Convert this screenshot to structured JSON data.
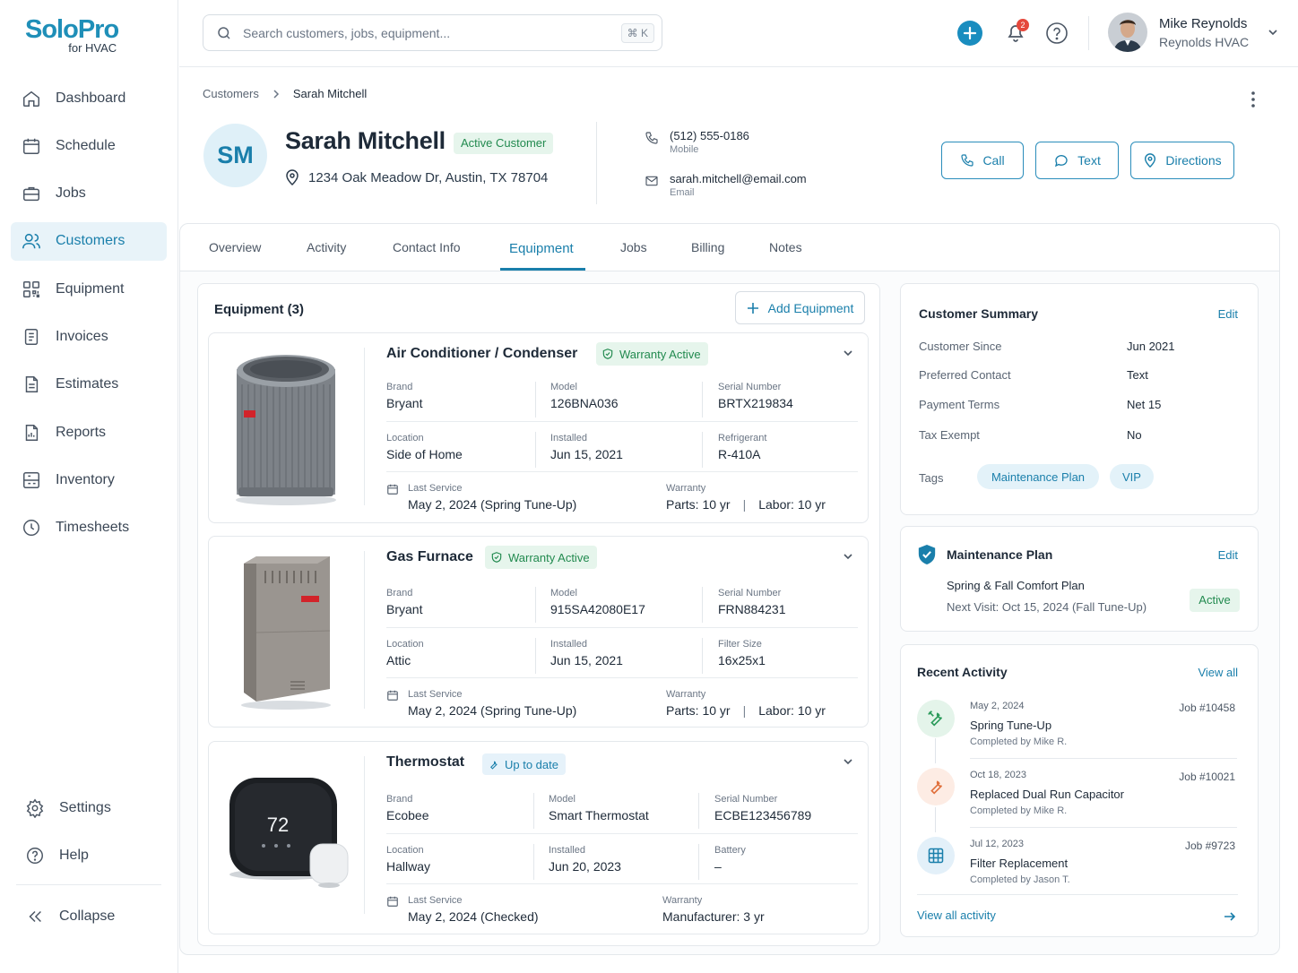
{
  "app": {
    "logo_main": "SoloPro",
    "logo_sub": "for HVAC"
  },
  "sidebar": {
    "items": [
      {
        "label": "Dashboard",
        "icon": "home-icon"
      },
      {
        "label": "Schedule",
        "icon": "calendar-icon"
      },
      {
        "label": "Jobs",
        "icon": "briefcase-icon"
      },
      {
        "label": "Customers",
        "icon": "users-icon",
        "active": true
      },
      {
        "label": "Equipment",
        "icon": "grid-icon"
      },
      {
        "label": "Invoices",
        "icon": "invoice-icon"
      },
      {
        "label": "Estimates",
        "icon": "estimate-icon"
      },
      {
        "label": "Reports",
        "icon": "report-icon"
      },
      {
        "label": "Inventory",
        "icon": "inventory-icon"
      },
      {
        "label": "Timesheets",
        "icon": "clock-icon"
      }
    ],
    "settings": "Settings",
    "help": "Help",
    "collapse": "Collapse"
  },
  "header": {
    "search_placeholder": "Search customers, jobs, equipment...",
    "shortcut": "⌘ K",
    "notification_count": "2",
    "user_name": "Mike Reynolds",
    "user_company": "Reynolds HVAC"
  },
  "breadcrumb": {
    "parent": "Customers",
    "current": "Sarah Mitchell"
  },
  "customer": {
    "initials": "SM",
    "name": "Sarah Mitchell",
    "status": "Active Customer",
    "address": "1234 Oak Meadow Dr, Austin, TX 78704",
    "phone": "(512) 555-0186",
    "phone_type": "Mobile",
    "email": "sarah.mitchell@email.com",
    "email_type": "Email"
  },
  "actions": {
    "call": "Call",
    "text": "Text",
    "directions": "Directions"
  },
  "tabs": [
    "Overview",
    "Activity",
    "Contact Info",
    "Equipment",
    "Jobs",
    "Billing",
    "Notes"
  ],
  "equipment": {
    "title": "Equipment (3)",
    "add_label": "Add Equipment",
    "items": [
      {
        "name": "Air Conditioner / Condenser",
        "badge": "Warranty Active",
        "f": [
          {
            "label": "Brand",
            "value": "Bryant"
          },
          {
            "label": "Model",
            "value": "126BNA036"
          },
          {
            "label": "Serial Number",
            "value": "BRTX219834"
          },
          {
            "label": "Location",
            "value": "Side of Home"
          },
          {
            "label": "Installed",
            "value": "Jun 15, 2021"
          },
          {
            "label": "Refrigerant",
            "value": "R-410A"
          }
        ],
        "last_service_label": "Last Service",
        "last_service": "May 2, 2024 (Spring Tune-Up)",
        "warranty_label": "Warranty",
        "warranty_parts": "Parts: 10 yr",
        "warranty_labor": "Labor: 10 yr"
      },
      {
        "name": "Gas Furnace",
        "badge": "Warranty Active",
        "f": [
          {
            "label": "Brand",
            "value": "Bryant"
          },
          {
            "label": "Model",
            "value": "915SA42080E17"
          },
          {
            "label": "Serial Number",
            "value": "FRN884231"
          },
          {
            "label": "Location",
            "value": "Attic"
          },
          {
            "label": "Installed",
            "value": "Jun 15, 2021"
          },
          {
            "label": "Filter Size",
            "value": "16x25x1"
          }
        ],
        "last_service_label": "Last Service",
        "last_service": "May 2, 2024 (Spring Tune-Up)",
        "warranty_label": "Warranty",
        "warranty_parts": "Parts: 10 yr",
        "warranty_labor": "Labor: 10 yr"
      },
      {
        "name": "Thermostat",
        "badge": "Up to date",
        "display_temp": "72",
        "f": [
          {
            "label": "Brand",
            "value": "Ecobee"
          },
          {
            "label": "Model",
            "value": "Smart Thermostat"
          },
          {
            "label": "Serial Number",
            "value": "ECBE123456789"
          },
          {
            "label": "Location",
            "value": "Hallway"
          },
          {
            "label": "Installed",
            "value": "Jun 20, 2023"
          },
          {
            "label": "Battery",
            "value": "–"
          }
        ],
        "last_service_label": "Last Service",
        "last_service": "May 2, 2024 (Checked)",
        "warranty_label": "Warranty",
        "warranty": "Manufacturer: 3 yr"
      }
    ]
  },
  "summary": {
    "title": "Customer Summary",
    "edit": "Edit",
    "rows": [
      {
        "label": "Customer Since",
        "value": "Jun 2021"
      },
      {
        "label": "Preferred Contact",
        "value": "Text"
      },
      {
        "label": "Payment Terms",
        "value": "Net 15"
      },
      {
        "label": "Tax Exempt",
        "value": "No"
      }
    ],
    "tags_label": "Tags",
    "tags": [
      "Maintenance Plan",
      "VIP"
    ]
  },
  "plan": {
    "title": "Maintenance Plan",
    "edit": "Edit",
    "name": "Spring & Fall Comfort Plan",
    "next_visit": "Next Visit: Oct 15, 2024 (Fall Tune-Up)",
    "status": "Active"
  },
  "activity": {
    "title": "Recent Activity",
    "view_all": "View all",
    "items": [
      {
        "date": "May 2, 2024",
        "name": "Spring Tune-Up",
        "by": "Completed by Mike R.",
        "job": "Job #10458"
      },
      {
        "date": "Oct 18, 2023",
        "name": "Replaced Dual Run Capacitor",
        "by": "Completed by Mike R.",
        "job": "Job #10021"
      },
      {
        "date": "Jul 12, 2023",
        "name": "Filter Replacement",
        "by": "Completed by Jason T.",
        "job": "Job #9723"
      }
    ],
    "footer_link": "View all activity"
  },
  "colors": {
    "accent": "#1a7fab",
    "success": "#228a4f",
    "notification": "#e5483c"
  }
}
